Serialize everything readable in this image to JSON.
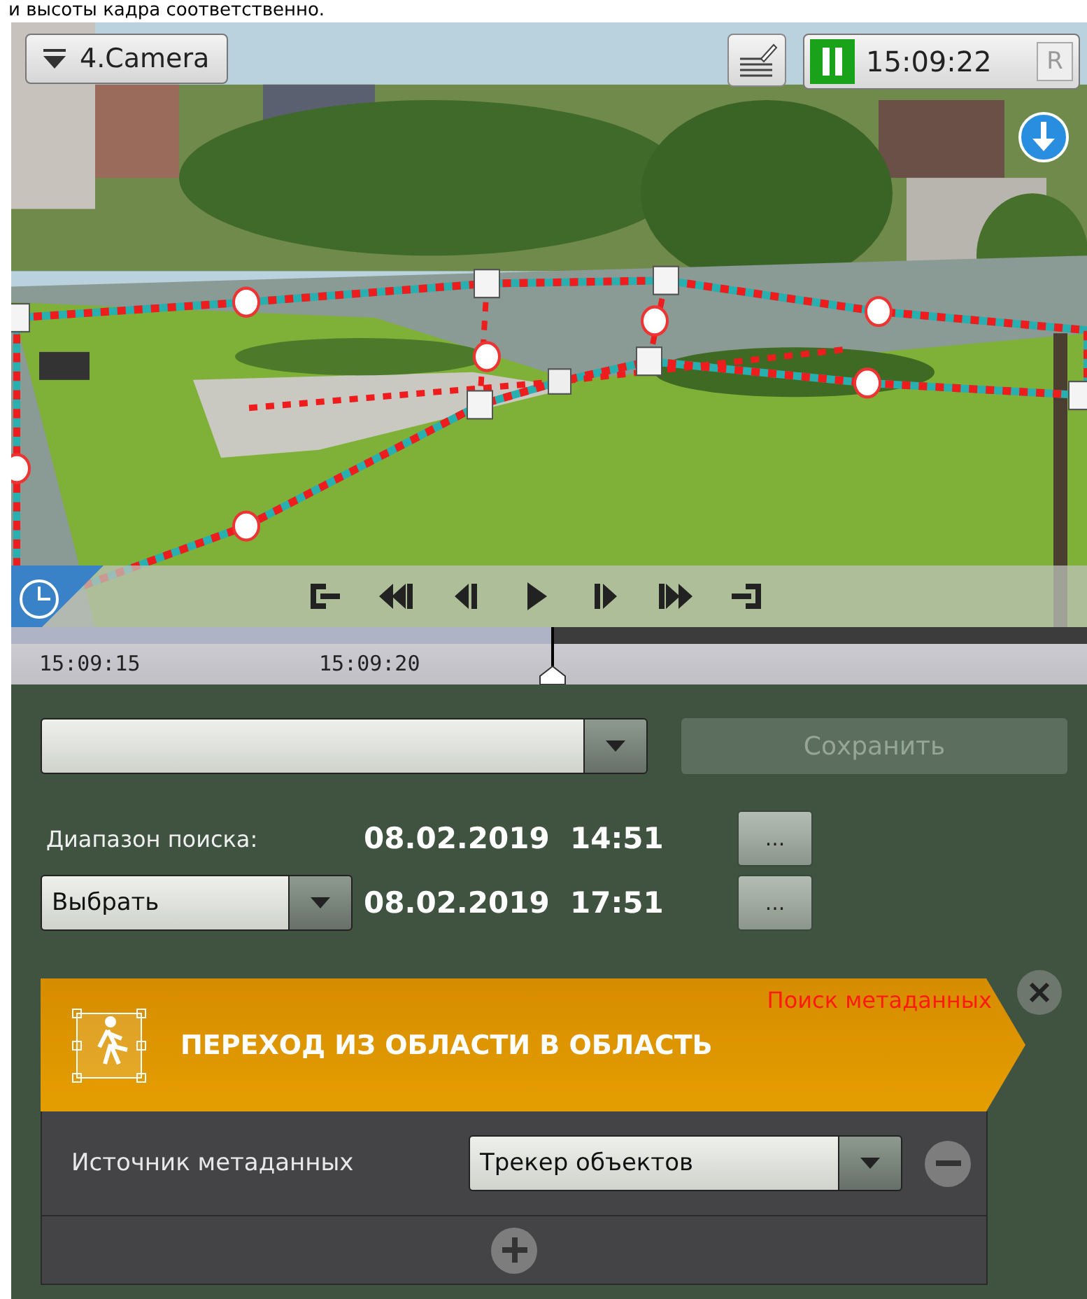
{
  "caption": "и высоты кадра соответственно.",
  "camera": {
    "name": "4.Camera",
    "time": "15:09:22",
    "paused": true,
    "record_label": "R"
  },
  "timeline": {
    "labels": [
      "15:09:15",
      "15:09:20"
    ],
    "level": 0.503
  },
  "search": {
    "save_button": {
      "label": "Сохранить",
      "disabled": true
    },
    "range_label": "Диапазон поиска:",
    "from": {
      "date": "08.02.2019",
      "time": "14:51",
      "button": "..."
    },
    "period_select": "Выбрать",
    "to": {
      "date": "08.02.2019",
      "time": "17:51",
      "button": "..."
    }
  },
  "filter": {
    "category": "Поиск метаданных",
    "title": "ПЕРЕХОД ИЗ ОБЛАСТИ В ОБЛАСТЬ",
    "rows": [
      {
        "label": "Источник метаданных",
        "value": "Трекер объектов"
      }
    ]
  }
}
